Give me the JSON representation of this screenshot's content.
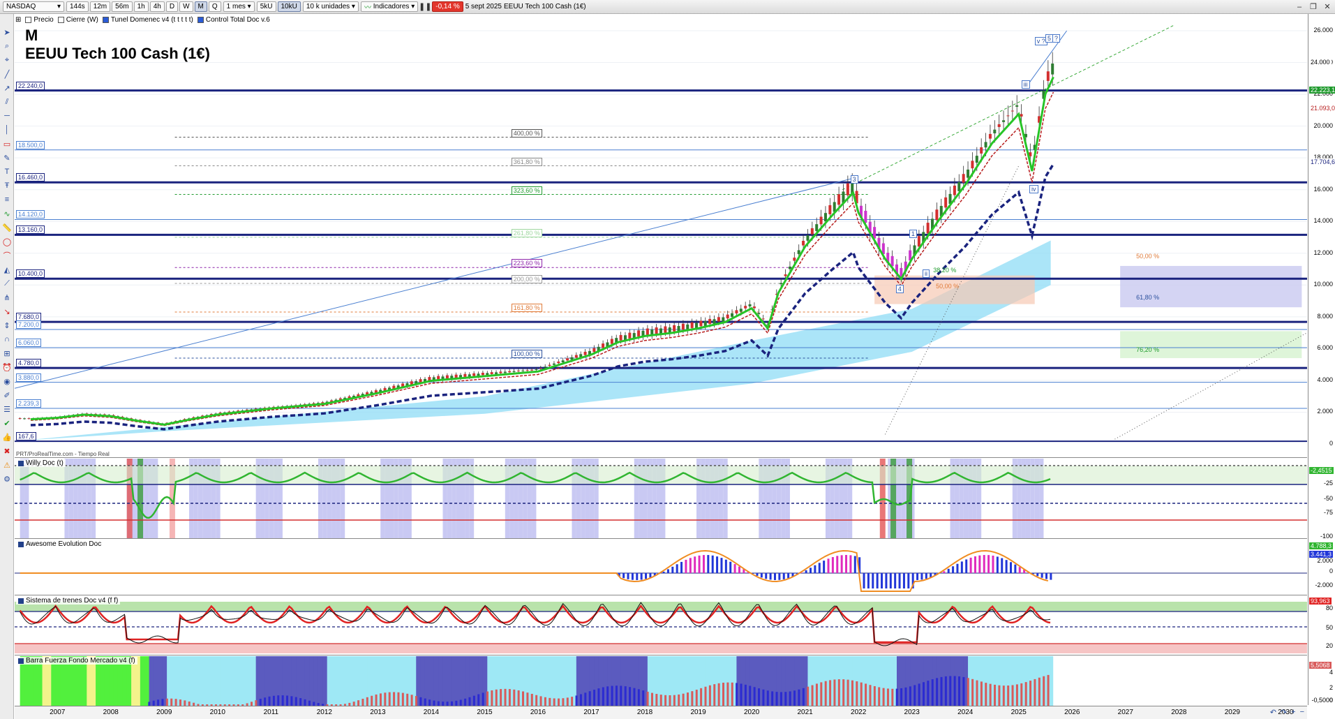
{
  "toolbar": {
    "symbol": "NASDAQ",
    "timeframes": [
      "144s",
      "12m",
      "56m",
      "1h",
      "4h",
      "D",
      "W",
      "M",
      "Q"
    ],
    "active_timeframe": "M",
    "period": "1 mes",
    "units": [
      "5kU",
      "10kU"
    ],
    "active_unit": "10kU",
    "units_select": "10 k unidades",
    "indicators_label": "Indicadores",
    "change": "-0,14 %",
    "date": "5 sept 2025",
    "instrument": "EEUU Tech 100 Cash (1€)"
  },
  "tabs": [
    {
      "label": "Precio",
      "checked": false
    },
    {
      "label": "Cierre (W)",
      "checked": false
    },
    {
      "label": "Tunel Domenec v4 (t t t t t)",
      "checked": false
    },
    {
      "label": "Control Total Doc v.6",
      "checked": false
    }
  ],
  "main": {
    "period_label": "M",
    "title": "EEUU Tech 100 Cash (1€)",
    "source_note": "PRT/ProRealTime.com - Tiempo Real",
    "levels": [
      {
        "label": "22.240,0",
        "price": 22240,
        "color": "#1a237e",
        "width": 3
      },
      {
        "label": "18.500,0",
        "price": 18500,
        "color": "#4a7fd0",
        "width": 1
      },
      {
        "label": "16.460,0",
        "price": 16460,
        "color": "#1a237e",
        "width": 3
      },
      {
        "label": "14.120,0",
        "price": 14120,
        "color": "#4a7fd0",
        "width": 1
      },
      {
        "label": "13.160,0",
        "price": 13160,
        "color": "#1a237e",
        "width": 3
      },
      {
        "label": "10.400,0",
        "price": 10400,
        "color": "#1a237e",
        "width": 3
      },
      {
        "label": "7.680,0",
        "price": 7680,
        "color": "#1a237e",
        "width": 3
      },
      {
        "label": "7.200,0",
        "price": 7200,
        "color": "#4a7fd0",
        "width": 1
      },
      {
        "label": "6.060,0",
        "price": 6060,
        "color": "#4a7fd0",
        "width": 1
      },
      {
        "label": "4.780,0",
        "price": 4780,
        "color": "#1a237e",
        "width": 3
      },
      {
        "label": "3.880,0",
        "price": 3880,
        "color": "#4a7fd0",
        "width": 1
      },
      {
        "label": "2.239,3",
        "price": 2239,
        "color": "#4a7fd0",
        "width": 1
      },
      {
        "label": "167,6",
        "price": 168,
        "color": "#1a237e",
        "width": 2
      }
    ],
    "fib_labels": [
      {
        "label": "400,00 %",
        "price": 19300,
        "color": "#555"
      },
      {
        "label": "361,80 %",
        "price": 17500,
        "color": "#888"
      },
      {
        "label": "323,60 %",
        "price": 15700,
        "color": "#1f9a2d"
      },
      {
        "label": "261,80 %",
        "price": 13000,
        "color": "#9fd79f"
      },
      {
        "label": "223,60 %",
        "price": 11100,
        "color": "#8e24aa"
      },
      {
        "label": "200,00 %",
        "price": 10100,
        "color": "#999"
      },
      {
        "label": "161,80 %",
        "price": 8300,
        "color": "#e07b39"
      },
      {
        "label": "100,00 %",
        "price": 5400,
        "color": "#2a4f9c"
      }
    ],
    "retracement_labels": [
      {
        "label": "38,20 %",
        "color": "#1f9a2d"
      },
      {
        "label": "50,00 %",
        "color": "#e07b39"
      },
      {
        "label": "50,00 %",
        "color": "#e07b39"
      },
      {
        "label": "61,80 %",
        "color": "#2a4f9c"
      },
      {
        "label": "76,20 %",
        "color": "#1f9a2d"
      }
    ],
    "waves": [
      "v ?",
      "5",
      "?",
      "iii",
      "3",
      "1",
      "ii",
      "4",
      "iv"
    ]
  },
  "price_axis": {
    "ticks": [
      "26.000",
      "24.000",
      "22.000",
      "20.000",
      "18.000",
      "16.000",
      "14.000",
      "12.000",
      "10.000",
      "8.000",
      "6.000",
      "4.000",
      "2.000",
      "0"
    ],
    "tags": [
      {
        "label": "24.000",
        "bg": "#ffffff",
        "fg": "#000000"
      },
      {
        "label": "22.223,1",
        "bg": "#1f9a2d",
        "fg": "#ffffff"
      },
      {
        "label": "21.093,0",
        "bg": "#ffffff",
        "fg": "#b71c1c"
      },
      {
        "label": "17.704,6",
        "bg": "#ffffff",
        "fg": "#1a237e"
      }
    ]
  },
  "willy": {
    "title": "Willy Doc (t)",
    "ticks": [
      "-25",
      "-50",
      "-75",
      "-100"
    ],
    "tag": "-2,4515"
  },
  "awesome": {
    "title": "Awesome Evolution Doc",
    "ticks": [
      "2.000",
      "0",
      "-2.000"
    ],
    "tags": [
      "4.788,3",
      "3.441,3"
    ]
  },
  "trenes": {
    "title": "Sistema de trenes Doc v4 (f f)",
    "ticks": [
      "80",
      "50",
      "20"
    ],
    "tag": "93,963"
  },
  "barra": {
    "title": "Barra Fuerza Fondo Mercado v4 (f)",
    "ticks": [
      "4",
      "2",
      "0"
    ],
    "tag": "5,5068",
    "tag2": "-0,5000"
  },
  "time_axis": {
    "years": [
      "2007",
      "2008",
      "2009",
      "2010",
      "2011",
      "2012",
      "2013",
      "2014",
      "2015",
      "2016",
      "2017",
      "2018",
      "2019",
      "2020",
      "2021",
      "2022",
      "2023",
      "2024",
      "2025",
      "2026",
      "2027",
      "2028",
      "2029",
      "2030"
    ]
  },
  "chart_data": {
    "type": "line",
    "title": "EEUU Tech 100 Cash (1€)",
    "x": [
      2006.5,
      2007,
      2007.5,
      2008,
      2008.5,
      2009,
      2009.5,
      2010,
      2011,
      2012,
      2013,
      2014,
      2015,
      2016,
      2017,
      2017.5,
      2018,
      2018.5,
      2019,
      2019.5,
      2020,
      2020.3,
      2020.5,
      2021,
      2021.5,
      2021.9,
      2022,
      2022.5,
      2022.8,
      2023,
      2023.5,
      2024,
      2024.5,
      2025,
      2025.25,
      2025.5,
      2025.65
    ],
    "series": [
      {
        "values": [
          1600,
          1700,
          1900,
          1800,
          1500,
          1250,
          1600,
          1900,
          2300,
          2600,
          3300,
          4100,
          4400,
          4700,
          5800,
          6600,
          7000,
          7200,
          7500,
          7900,
          8800,
          7500,
          9800,
          12800,
          14800,
          16300,
          15000,
          12000,
          10700,
          12000,
          14500,
          16800,
          19500,
          21400,
          17700,
          22700,
          23800
        ]
      }
    ],
    "ylim": [
      0,
      26000
    ],
    "xlim": [
      2006.2,
      2030.4
    ]
  }
}
